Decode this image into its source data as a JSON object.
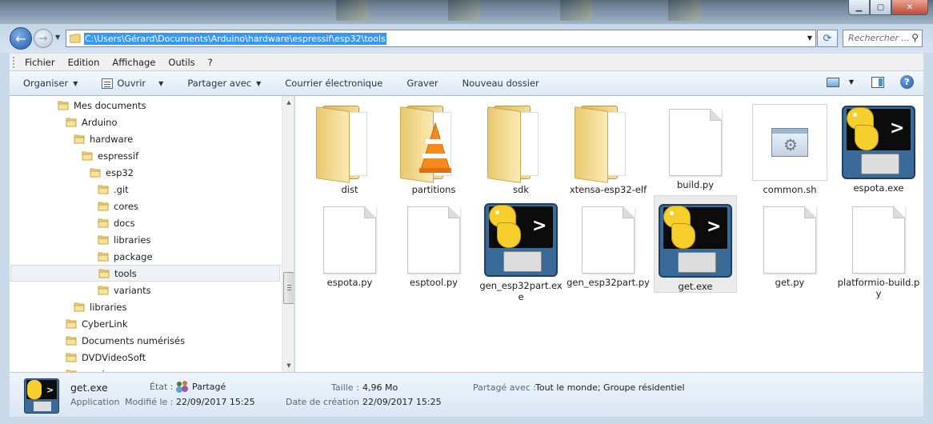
{
  "address": {
    "path": "C:\\Users\\Gérard\\Documents\\Arduino\\hardware\\espressif\\esp32\\tools",
    "search_placeholder": "Rechercher ..."
  },
  "menu": [
    "Fichier",
    "Edition",
    "Affichage",
    "Outils",
    "?"
  ],
  "toolbar": {
    "organiser": "Organiser",
    "ouvrir": "Ouvrir",
    "partager": "Partager avec",
    "courrier": "Courrier électronique",
    "graver": "Graver",
    "nouveau": "Nouveau dossier"
  },
  "tree": [
    {
      "label": "Mes documents",
      "level": 0
    },
    {
      "label": "Arduino",
      "level": 1
    },
    {
      "label": "hardware",
      "level": 2
    },
    {
      "label": "espressif",
      "level": 3
    },
    {
      "label": "esp32",
      "level": 4
    },
    {
      "label": ".git",
      "level": 5
    },
    {
      "label": "cores",
      "level": 5
    },
    {
      "label": "docs",
      "level": 5
    },
    {
      "label": "libraries",
      "level": 5
    },
    {
      "label": "package",
      "level": 5
    },
    {
      "label": "tools",
      "level": 5,
      "selected": true
    },
    {
      "label": "variants",
      "level": 5
    },
    {
      "label": "libraries",
      "level": 2
    },
    {
      "label": "CyberLink",
      "level": 1
    },
    {
      "label": "Documents numérisés",
      "level": 1
    },
    {
      "label": "DVDVideoSoft",
      "level": 1
    },
    {
      "label": "e-anim",
      "level": 1
    }
  ],
  "files": [
    {
      "label": "dist",
      "icon": "folder-icon"
    },
    {
      "label": "partitions",
      "icon": "vlc-folder-icon"
    },
    {
      "label": "sdk",
      "icon": "folder-icon"
    },
    {
      "label": "xtensa-esp32-elf",
      "icon": "folder-icon"
    },
    {
      "label": "build.py",
      "icon": "document-icon"
    },
    {
      "label": "common.sh",
      "icon": "script-gear-icon"
    },
    {
      "label": "espota.exe",
      "icon": "python-exe-icon"
    },
    {
      "label": "espota.py",
      "icon": "document-icon"
    },
    {
      "label": "esptool.py",
      "icon": "document-icon"
    },
    {
      "label": "gen_esp32part.exe",
      "icon": "python-exe-icon"
    },
    {
      "label": "gen_esp32part.py",
      "icon": "document-icon"
    },
    {
      "label": "get.exe",
      "icon": "python-exe-icon",
      "selected": true
    },
    {
      "label": "get.py",
      "icon": "document-icon"
    },
    {
      "label": "platformio-build.py",
      "icon": "document-icon"
    }
  ],
  "details": {
    "name": "get.exe",
    "type": "Application",
    "etat_key": "État :",
    "etat_val": "Partagé",
    "modifie_key": "Modifié le :",
    "modifie_val": "22/09/2017 15:25",
    "taille_key": "Taille :",
    "taille_val": "4,96 Mo",
    "creation_key": "Date de création :",
    "creation_val": "22/09/2017 15:25",
    "partage_key": "Partagé avec :",
    "partage_val": "Tout le monde; Groupe résidentiel"
  }
}
